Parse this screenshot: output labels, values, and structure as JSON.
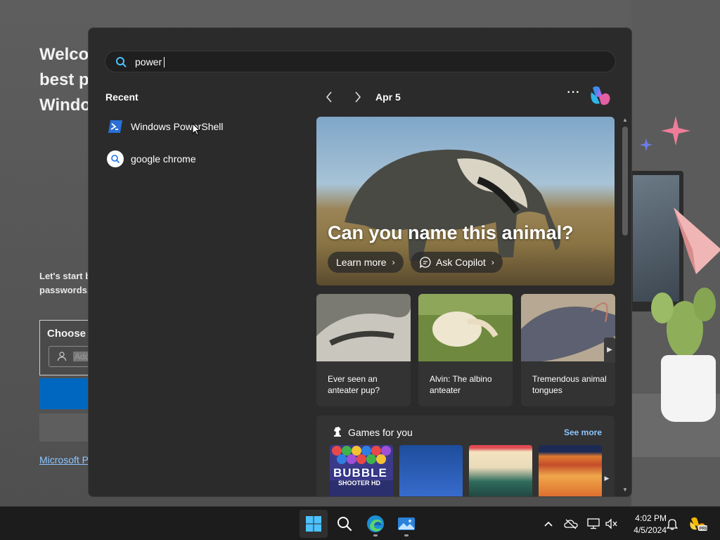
{
  "background_app": {
    "welcome_lines": [
      "Welco",
      "best p",
      "Windo"
    ],
    "description_lines": [
      "Let's start b",
      "passwords,"
    ],
    "card_title": "Choose",
    "input_placeholder": "Add",
    "link_text": "Microsoft P"
  },
  "start_menu": {
    "search": {
      "value": "power",
      "icon": "search-icon"
    },
    "recent": {
      "title": "Recent",
      "items": [
        {
          "label": "Windows PowerShell",
          "icon": "powershell-icon"
        },
        {
          "label": "google chrome",
          "icon": "search-icon"
        }
      ]
    },
    "feed": {
      "date": "Apr 5",
      "more": "···",
      "hero": {
        "title": "Can you name this animal?",
        "learn_more": "Learn more",
        "ask_copilot": "Ask Copilot"
      },
      "cards": [
        {
          "text": "Ever seen an anteater pup?"
        },
        {
          "text": "Alvin: The albino anteater"
        },
        {
          "text": "Tremendous animal tongues"
        }
      ],
      "games": {
        "title": "Games for you",
        "see_more": "See more",
        "tiles": [
          {
            "label": "BUBBLE",
            "sublabel": "SHOOTER HD"
          },
          {
            "label": ""
          },
          {
            "label": ""
          },
          {
            "label": ""
          }
        ]
      }
    }
  },
  "taskbar": {
    "clock_time": "4:02 PM",
    "clock_date": "4/5/2024"
  },
  "colors": {
    "accent": "#0067c0",
    "link": "#8cc6ff",
    "panel": "#2b2b2b",
    "card": "#333333",
    "taskbar": "#1c1c1c"
  }
}
